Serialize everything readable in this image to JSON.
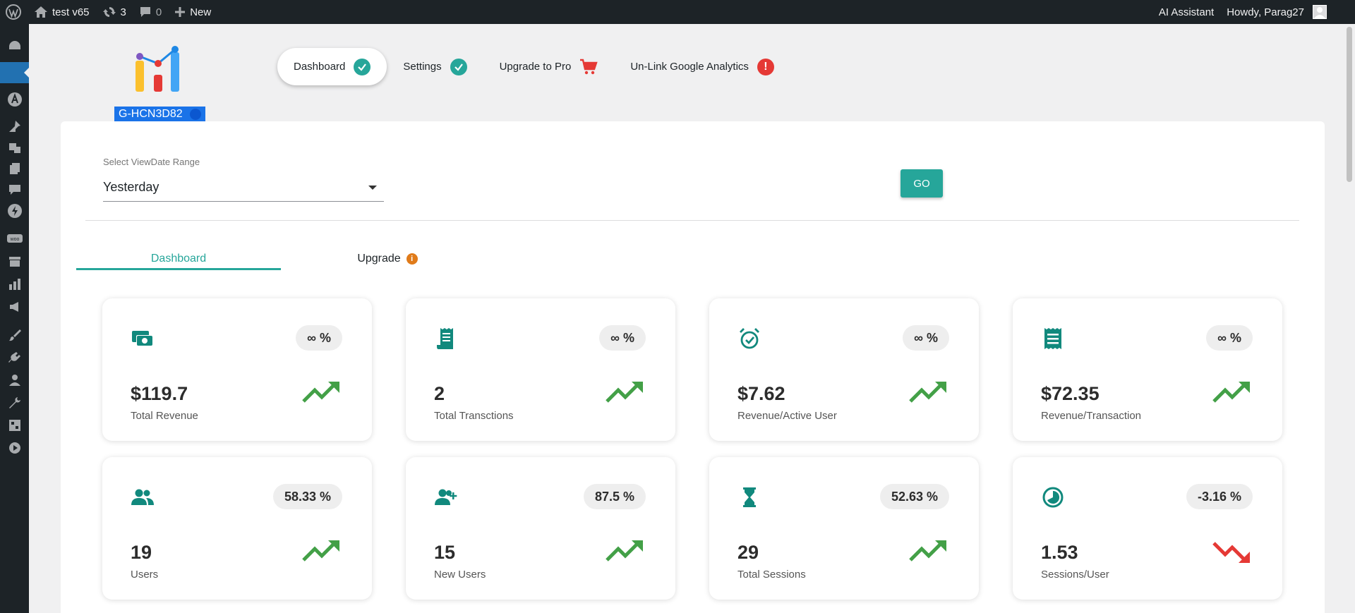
{
  "adminbar": {
    "site_name": "test v65",
    "updates_count": "3",
    "comments_count": "0",
    "new_label": "New",
    "ai_assistant": "AI Assistant",
    "howdy": "Howdy, Parag27"
  },
  "plugin": {
    "property_id": "G-HCN3D82",
    "nav": [
      {
        "label": "Dashboard",
        "status": "check"
      },
      {
        "label": "Settings",
        "status": "check"
      },
      {
        "label": "Upgrade to Pro",
        "status": "cart"
      },
      {
        "label": "Un-Link Google Analytics",
        "status": "alert"
      }
    ]
  },
  "filter": {
    "label": "Select ViewDate Range",
    "selected": "Yesterday",
    "go_label": "GO"
  },
  "tabs": {
    "dashboard": "Dashboard",
    "upgrade": "Upgrade",
    "upgrade_info": "i"
  },
  "cards": [
    {
      "icon": "money-icon",
      "badge": "∞ %",
      "value": "$119.7",
      "label": "Total Revenue",
      "trend": "up"
    },
    {
      "icon": "receipt-icon",
      "badge": "∞ %",
      "value": "2",
      "label": "Total Transctions",
      "trend": "up"
    },
    {
      "icon": "alarm-icon",
      "badge": "∞ %",
      "value": "$7.62",
      "label": "Revenue/Active User",
      "trend": "up"
    },
    {
      "icon": "list-receipt-icon",
      "badge": "∞ %",
      "value": "$72.35",
      "label": "Revenue/Transaction",
      "trend": "up"
    },
    {
      "icon": "users-icon",
      "badge": "58.33 %",
      "value": "19",
      "label": "Users",
      "trend": "up"
    },
    {
      "icon": "user-add-icon",
      "badge": "87.5 %",
      "value": "15",
      "label": "New Users",
      "trend": "up"
    },
    {
      "icon": "hourglass-icon",
      "badge": "52.63 %",
      "value": "29",
      "label": "Total Sessions",
      "trend": "up"
    },
    {
      "icon": "pie-icon",
      "badge": "-3.16 %",
      "value": "1.53",
      "label": "Sessions/User",
      "trend": "down"
    }
  ],
  "colors": {
    "accent": "#26a69a",
    "trend_up": "#43a047",
    "trend_down": "#e53935",
    "adminbar": "#1d2327"
  }
}
